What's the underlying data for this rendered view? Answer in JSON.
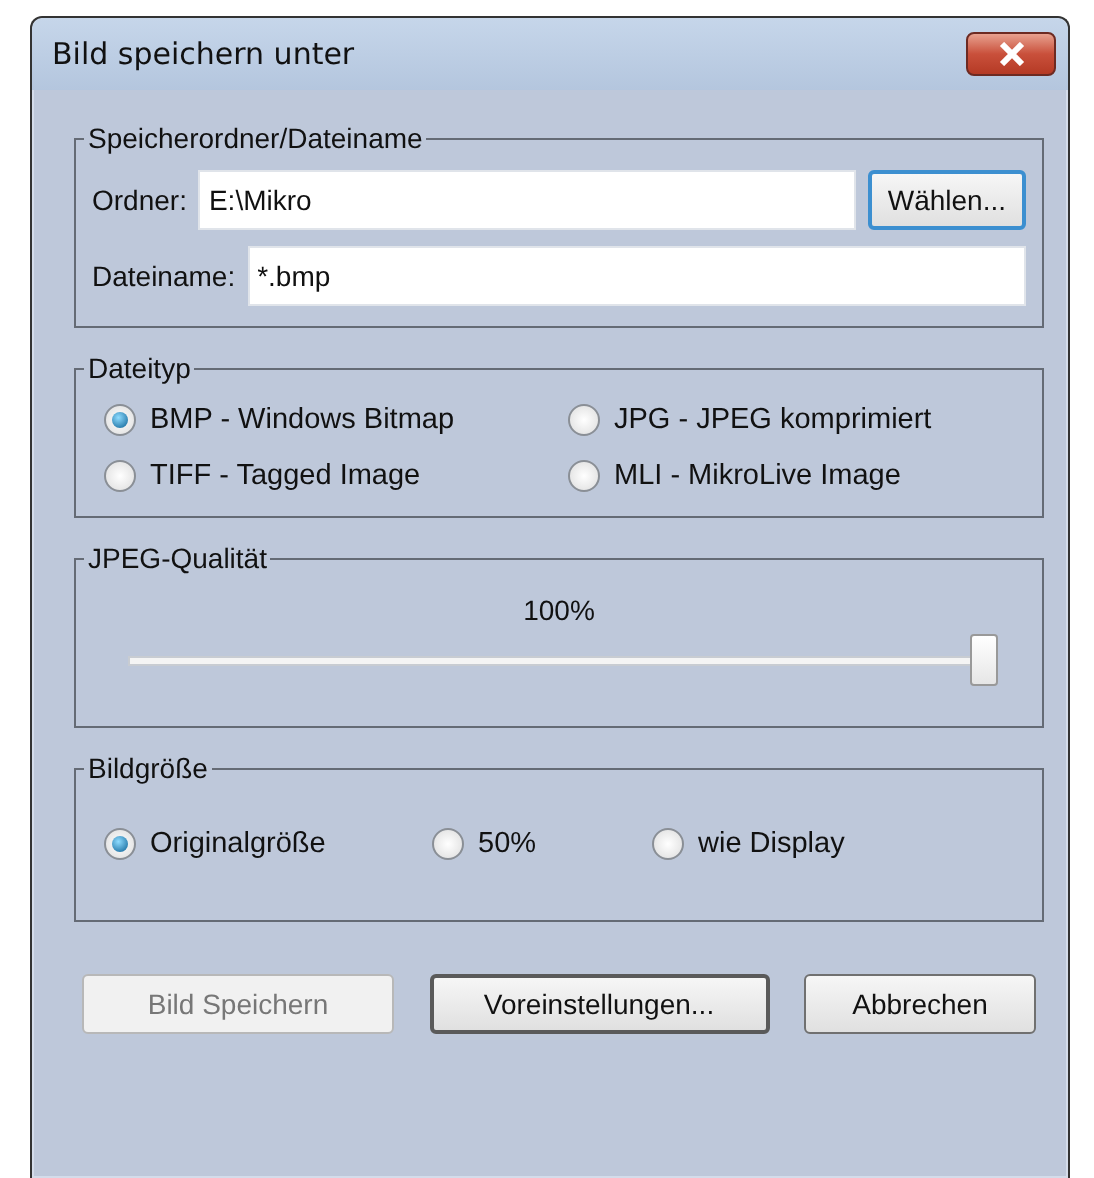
{
  "window": {
    "title": "Bild speichern unter"
  },
  "folder_group": {
    "legend": "Speicherordner/Dateiname",
    "folder": {
      "label": "Ordner:",
      "value": "E:\\Mikro"
    },
    "choose_button": {
      "label": "Wählen...",
      "focused": true
    },
    "filename": {
      "label": "Dateiname:",
      "value": "*.bmp"
    }
  },
  "filetype_group": {
    "legend": "Dateityp",
    "options": [
      {
        "label": "BMP - Windows Bitmap",
        "selected": true
      },
      {
        "label": "JPG - JPEG komprimiert",
        "selected": false
      },
      {
        "label": "TIFF - Tagged Image",
        "selected": false
      },
      {
        "label": "MLI - MikroLive Image",
        "selected": false
      }
    ]
  },
  "quality_group": {
    "legend": "JPEG-Qualität",
    "reading": "100%",
    "slider": {
      "level": 1
    }
  },
  "size_group": {
    "legend": "Bildgröße",
    "options": [
      {
        "label": "Originalgröße",
        "selected": true
      },
      {
        "label": "50%",
        "selected": false
      },
      {
        "label": "wie Display",
        "selected": false
      }
    ]
  },
  "buttons": [
    {
      "label": "Bild Speichern",
      "disabled": true,
      "default": false
    },
    {
      "label": "Voreinstellungen...",
      "disabled": false,
      "default": true
    },
    {
      "label": "Abbrechen",
      "disabled": false,
      "default": false
    }
  ]
}
